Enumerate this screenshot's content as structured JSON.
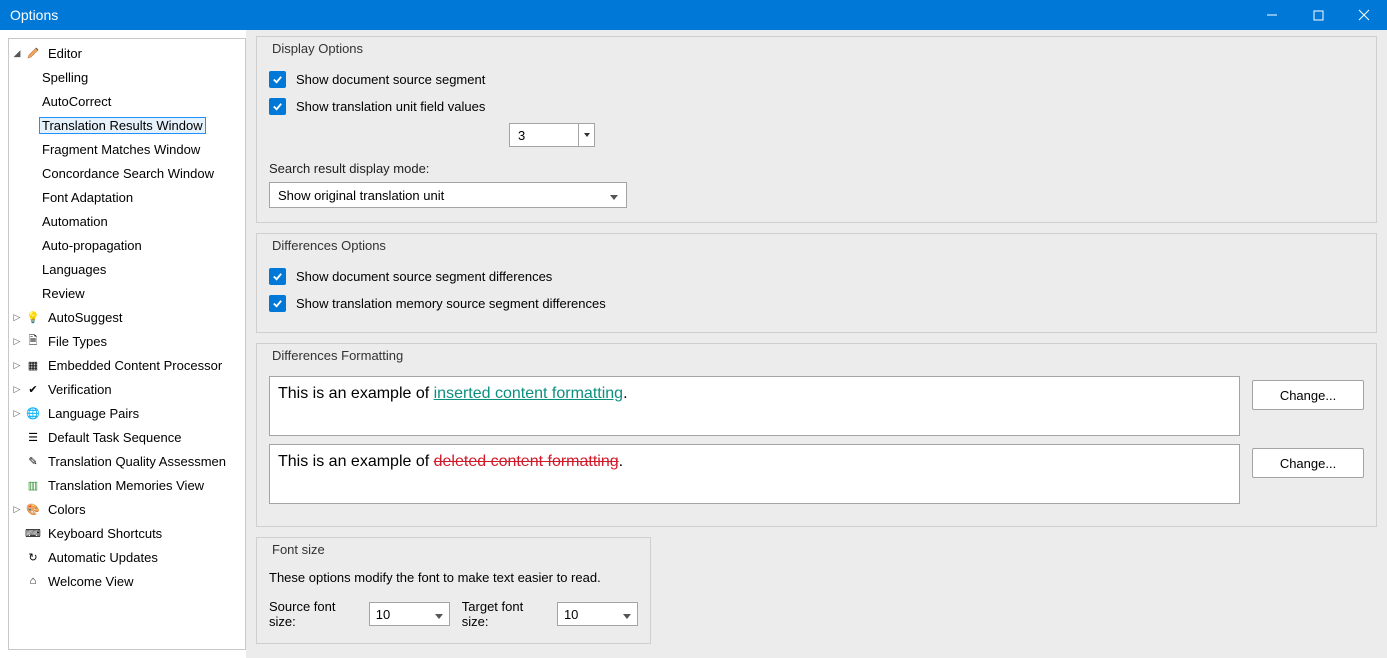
{
  "titlebar": {
    "title": "Options"
  },
  "tree": {
    "editor": {
      "label": "Editor",
      "children": {
        "spelling": "Spelling",
        "autocorrect": "AutoCorrect",
        "translation_results": "Translation Results Window",
        "fragment_matches": "Fragment Matches Window",
        "concordance": "Concordance Search Window",
        "font_adaptation": "Font Adaptation",
        "automation": "Automation",
        "auto_propagation": "Auto-propagation",
        "languages": "Languages",
        "review": "Review"
      }
    },
    "autosuggest": "AutoSuggest",
    "file_types": "File Types",
    "embedded": "Embedded Content Processor",
    "verification": "Verification",
    "language_pairs": "Language Pairs",
    "default_task": "Default Task Sequence",
    "quality": "Translation Quality Assessmen",
    "tm_view": "Translation Memories View",
    "colors": "Colors",
    "keyboard": "Keyboard Shortcuts",
    "updates": "Automatic Updates",
    "welcome": "Welcome View"
  },
  "display_options": {
    "legend": "Display Options",
    "show_source_segment": "Show document source segment",
    "show_field_values": "Show translation unit field values",
    "field_count": "3",
    "search_mode_label": "Search result display mode:",
    "search_mode_value": "Show original translation unit"
  },
  "diff_options": {
    "legend": "Differences Options",
    "show_doc_diff": "Show document source segment differences",
    "show_tm_diff": "Show translation memory source segment differences"
  },
  "diff_format": {
    "legend": "Differences Formatting",
    "inserted_prefix": "This is an example of ",
    "inserted_text": "inserted content formatting",
    "deleted_prefix": "This is an example of ",
    "deleted_text": "deleted content formatting",
    "suffix": ".",
    "change_btn": "Change..."
  },
  "font_size": {
    "legend": "Font size",
    "desc": "These options modify the font to make text easier to read.",
    "source_label": "Source font size:",
    "source_value": "10",
    "target_label": "Target font size:",
    "target_value": "10"
  }
}
